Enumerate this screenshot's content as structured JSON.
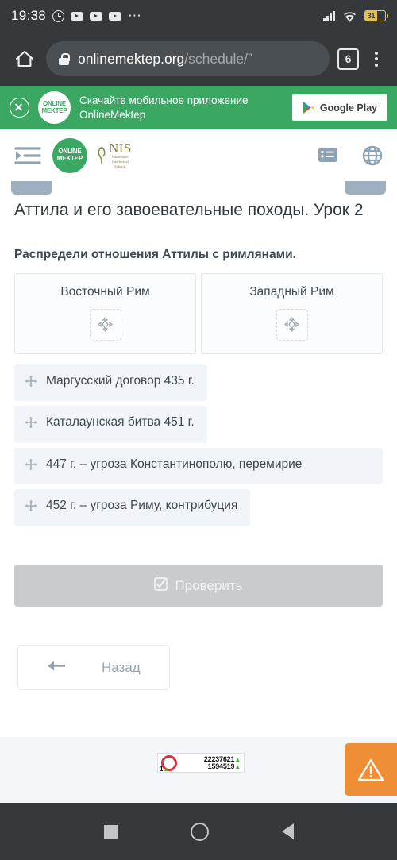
{
  "statusbar": {
    "time": "19:38",
    "icons": [
      "alarm-icon",
      "youtube-icon",
      "youtube-icon",
      "youtube-icon",
      "overflow-dots-icon"
    ],
    "signal": "signal-bars-icon",
    "wifi": "wifi-icon",
    "battery_level": "31"
  },
  "browser": {
    "home_icon": "home-icon",
    "lock_icon": "lock-icon",
    "url_domain": "onlinemektep.org",
    "url_path": "/schedule/ˮ",
    "tab_count": "6",
    "menu_icon": "overflow-menu-icon"
  },
  "app_banner": {
    "close_icon": "close-icon",
    "logo_line1": "ONLINE",
    "logo_line2": "MEKTEP",
    "text_line1": "Скачайте мобильное приложение",
    "text_line2": "OnlineMektep",
    "store_label": "Google Play"
  },
  "site_header": {
    "menu_icon": "indent-menu-icon",
    "logo_line1": "ONLINE",
    "logo_line2": "MEKTEP",
    "nis_abbr": "NIS",
    "nis_sub_line1": "Nazarbayev",
    "nis_sub_line2": "Intellectual",
    "nis_sub_line3": "Schools",
    "list_icon": "list-view-icon",
    "language_icon": "globe-icon"
  },
  "lesson": {
    "title": "Аттила и его завоевательные походы. Урок 2",
    "prompt": "Распредели отношения Аттилы с римлянами."
  },
  "dropzones": [
    {
      "label": "Восточный Рим",
      "slot_icon": "drop-target-icon"
    },
    {
      "label": "Западный Рим",
      "slot_icon": "drop-target-icon"
    }
  ],
  "draggables": [
    {
      "text": "Маргусский договор 435 г.",
      "handle_icon": "move-handle-icon"
    },
    {
      "text": "Каталаунская битва 451 г.",
      "handle_icon": "move-handle-icon"
    },
    {
      "text": "447 г. – угроза Константинополю, перемирие",
      "handle_icon": "move-handle-icon"
    },
    {
      "text": "452 г. – угроза Риму, контрибуция",
      "handle_icon": "move-handle-icon"
    }
  ],
  "actions": {
    "check_label": "Проверить",
    "check_icon": "checkbox-checked-icon",
    "back_label": "Назад",
    "back_icon": "arrow-left-icon"
  },
  "footer": {
    "counter": {
      "ring_icon": "counter-ring-icon",
      "total": "22237621",
      "today": "1594519",
      "online": "1",
      "trend_icon": "up-triangle-icon"
    },
    "warning_icon": "warning-triangle-icon"
  },
  "navbar": {
    "recents": "square-recents-icon",
    "home": "circle-home-icon",
    "back": "triangle-back-icon"
  },
  "colors": {
    "brand_green": "#3aa863",
    "warning_orange": "#ee8f35",
    "system_dark": "#35393c",
    "chip_bg": "#f1f4f8",
    "battery_yellow": "#e6c14a",
    "counter_red": "#e0303a",
    "trend_green": "#2fbb32"
  }
}
